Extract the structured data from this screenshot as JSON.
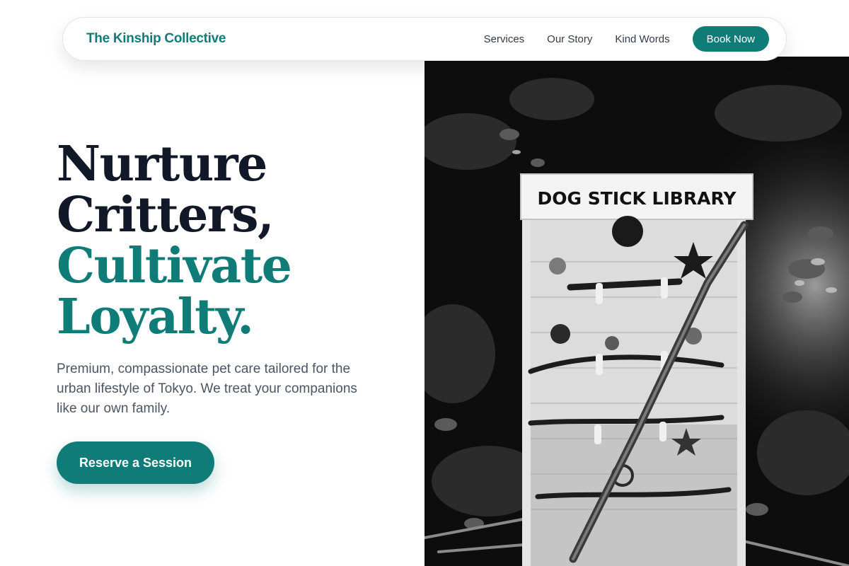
{
  "nav": {
    "brand": "The Kinship Collective",
    "links": [
      "Services",
      "Our Story",
      "Kind Words"
    ],
    "book_label": "Book Now"
  },
  "hero": {
    "title_line1": "Nurture",
    "title_line2": "Critters,",
    "title_line3": "Cultivate",
    "title_line4": "Loyalty.",
    "subtitle": "Premium, compassionate pet care tailored for the urban lifestyle of Tokyo. We treat your companions like our own family.",
    "cta_label": "Reserve a Session"
  },
  "photo": {
    "sign_text": "DOG STICK LIBRARY"
  },
  "colors": {
    "accent": "#0f7c78",
    "heading": "#111827",
    "body_text": "#4b5563"
  }
}
